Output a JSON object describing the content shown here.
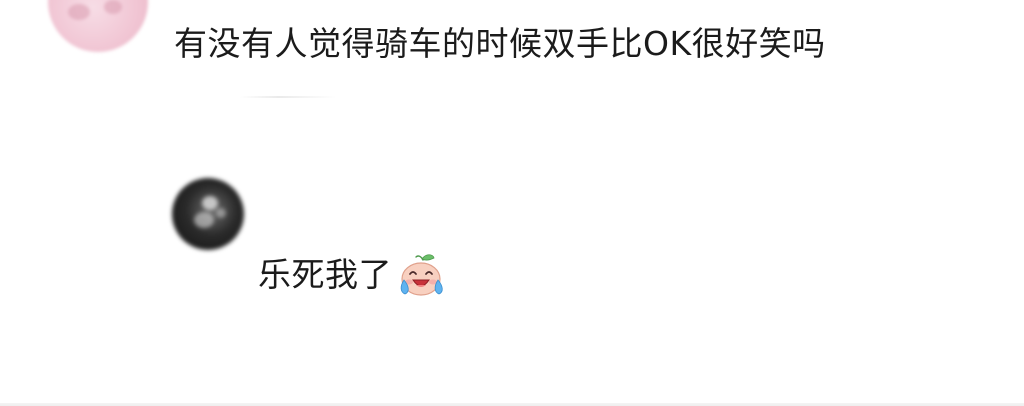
{
  "comments": [
    {
      "text": "有没有人觉得骑车的时候双手比OK很好笑吗",
      "avatar_icon": "user-avatar-pink"
    },
    {
      "text": "乐死我了",
      "avatar_icon": "user-avatar-dark",
      "emoji_icon": "laugh-cry-peach-emoji"
    }
  ]
}
